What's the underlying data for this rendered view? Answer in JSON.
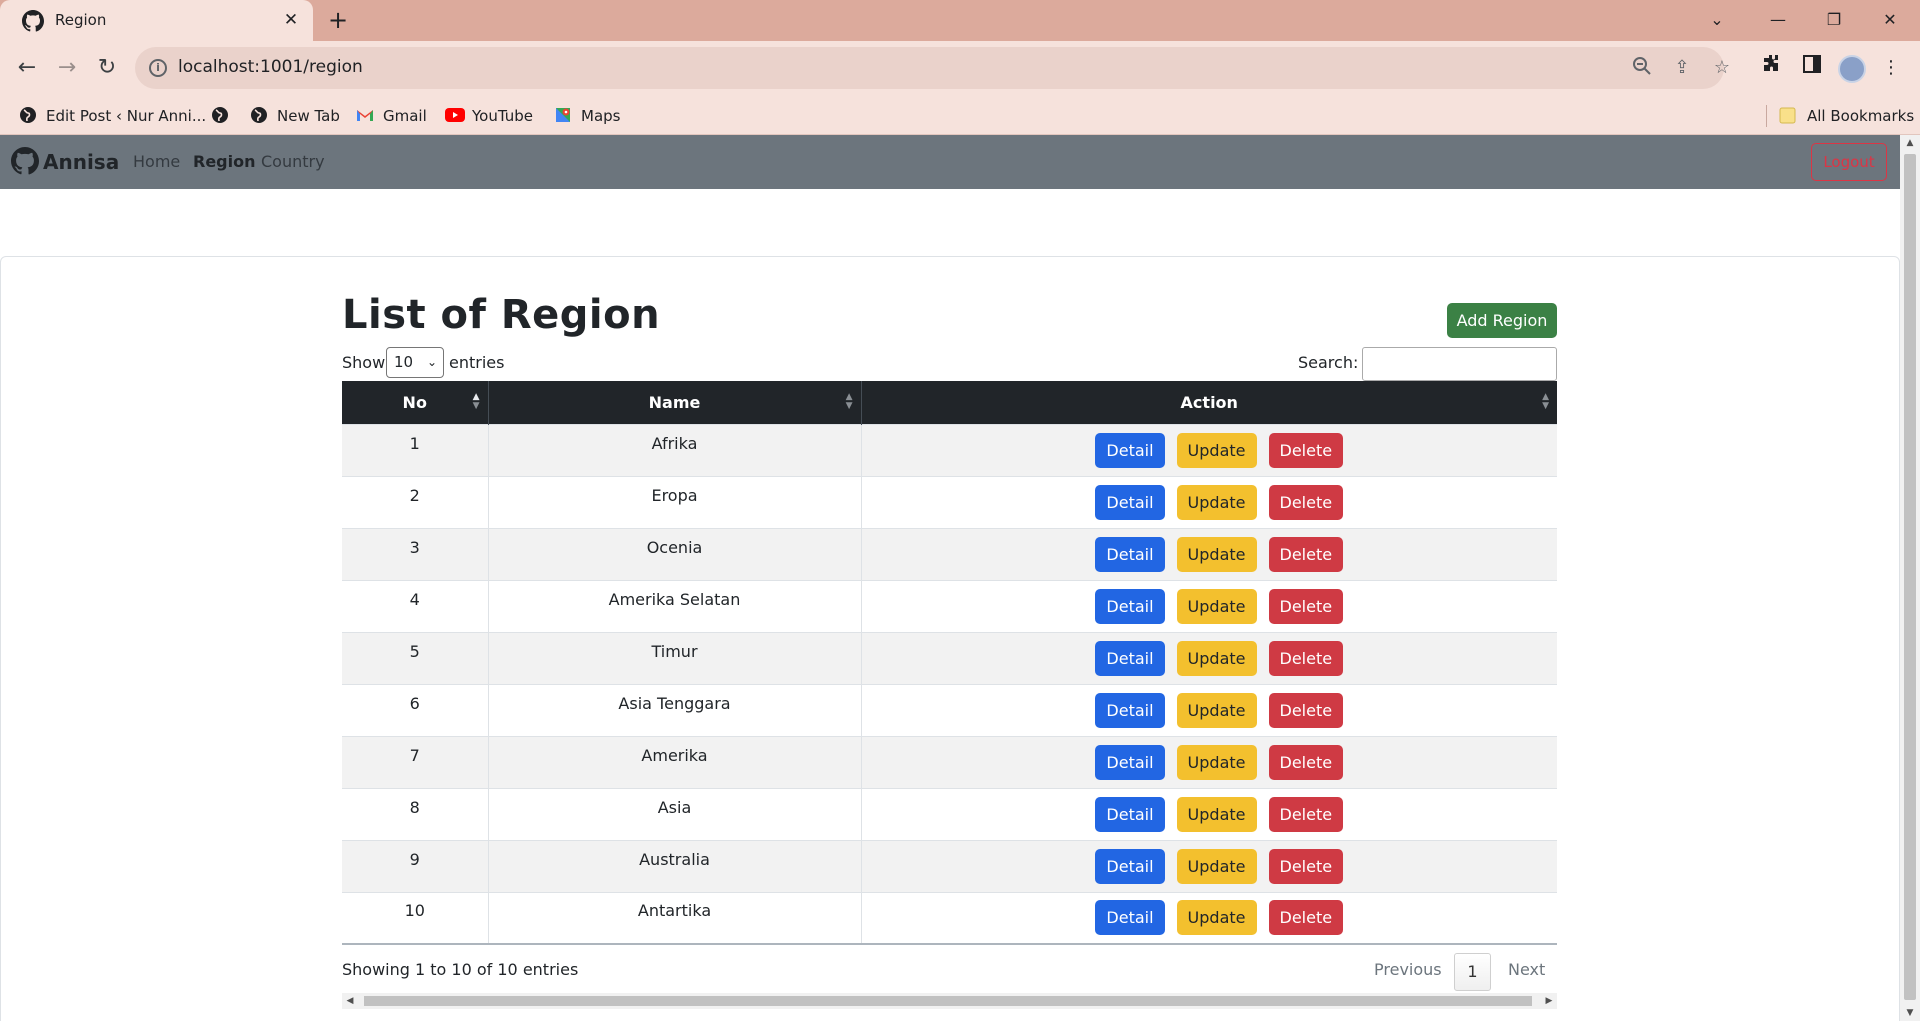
{
  "browser": {
    "tab_title": "Region",
    "tab_close": "✕",
    "new_tab": "+",
    "url": "localhost:1001/region",
    "bookmarks": [
      "Edit Post ‹ Nur Anni...",
      "",
      "New Tab",
      "Gmail",
      "YouTube",
      "Maps"
    ],
    "all_bookmarks": "All Bookmarks",
    "icons": [
      "github-icon",
      "back-arrow-icon",
      "forward-arrow-icon",
      "reload-icon",
      "site-info-icon",
      "zoom-icon",
      "share-icon",
      "star-icon",
      "extensions-icon",
      "side-panel-icon",
      "profile-avatar",
      "more-menu-icon"
    ]
  },
  "navbar": {
    "brand": "Annisa",
    "links": [
      "Home",
      "Region",
      "Country"
    ],
    "active": "Region",
    "logout": "Logout"
  },
  "main": {
    "title": "List of Region",
    "add_button": "Add Region",
    "show_label": "Show",
    "entries_label": "entries",
    "page_length": "10",
    "search_label": "Search:",
    "search_value": "",
    "columns": [
      "No",
      "Name",
      "Action"
    ],
    "rows": [
      {
        "no": "1",
        "name": "Afrika"
      },
      {
        "no": "2",
        "name": "Eropa"
      },
      {
        "no": "3",
        "name": "Ocenia"
      },
      {
        "no": "4",
        "name": "Amerika Selatan"
      },
      {
        "no": "5",
        "name": "Timur"
      },
      {
        "no": "6",
        "name": "Asia Tenggara"
      },
      {
        "no": "7",
        "name": "Amerika"
      },
      {
        "no": "8",
        "name": "Asia"
      },
      {
        "no": "9",
        "name": "Australia"
      },
      {
        "no": "10",
        "name": "Antartika"
      }
    ],
    "actions": {
      "detail": "Detail",
      "update": "Update",
      "delete": "Delete"
    },
    "info": "Showing 1 to 10 of 10 entries",
    "pagination": {
      "previous": "Previous",
      "current": "1",
      "next": "Next"
    }
  },
  "colors": {
    "navbar": "#6c757d",
    "table_header": "#212529",
    "add_button": "#3b8145",
    "detail": "#2266e3",
    "update": "#f3c02e",
    "delete": "#cf3a44",
    "chrome": "#f6e2dc"
  }
}
